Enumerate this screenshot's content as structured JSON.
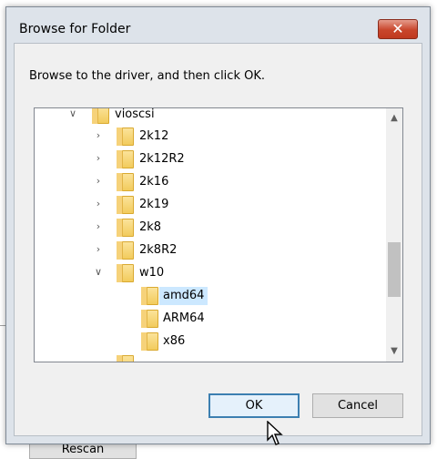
{
  "background": {
    "rescan_label": "Rescan"
  },
  "dialog": {
    "title": "Browse for Folder",
    "close_glyph": "✕",
    "instruction": "Browse to the driver, and then click OK.",
    "tree": [
      {
        "label": "vioscsi",
        "expander": "expanded",
        "icon": "folder-icon"
      },
      {
        "label": "2k12",
        "expander": "collapsed",
        "icon": "folder-icon"
      },
      {
        "label": "2k12R2",
        "expander": "collapsed",
        "icon": "folder-icon"
      },
      {
        "label": "2k16",
        "expander": "collapsed",
        "icon": "folder-icon"
      },
      {
        "label": "2k19",
        "expander": "collapsed",
        "icon": "folder-icon"
      },
      {
        "label": "2k8",
        "expander": "collapsed",
        "icon": "folder-icon"
      },
      {
        "label": "2k8R2",
        "expander": "collapsed",
        "icon": "folder-icon"
      },
      {
        "label": "w10",
        "expander": "expanded",
        "icon": "folder-icon"
      },
      {
        "label": "amd64",
        "expander": "none",
        "icon": "folder-icon",
        "selected": true
      },
      {
        "label": "ARM64",
        "expander": "none",
        "icon": "folder-icon"
      },
      {
        "label": "x86",
        "expander": "none",
        "icon": "folder-icon"
      }
    ],
    "ok_label": "OK",
    "cancel_label": "Cancel"
  },
  "colors": {
    "selection": "#cce8ff",
    "close_button": "#c8452b",
    "default_button_border": "#3c7fb1"
  }
}
